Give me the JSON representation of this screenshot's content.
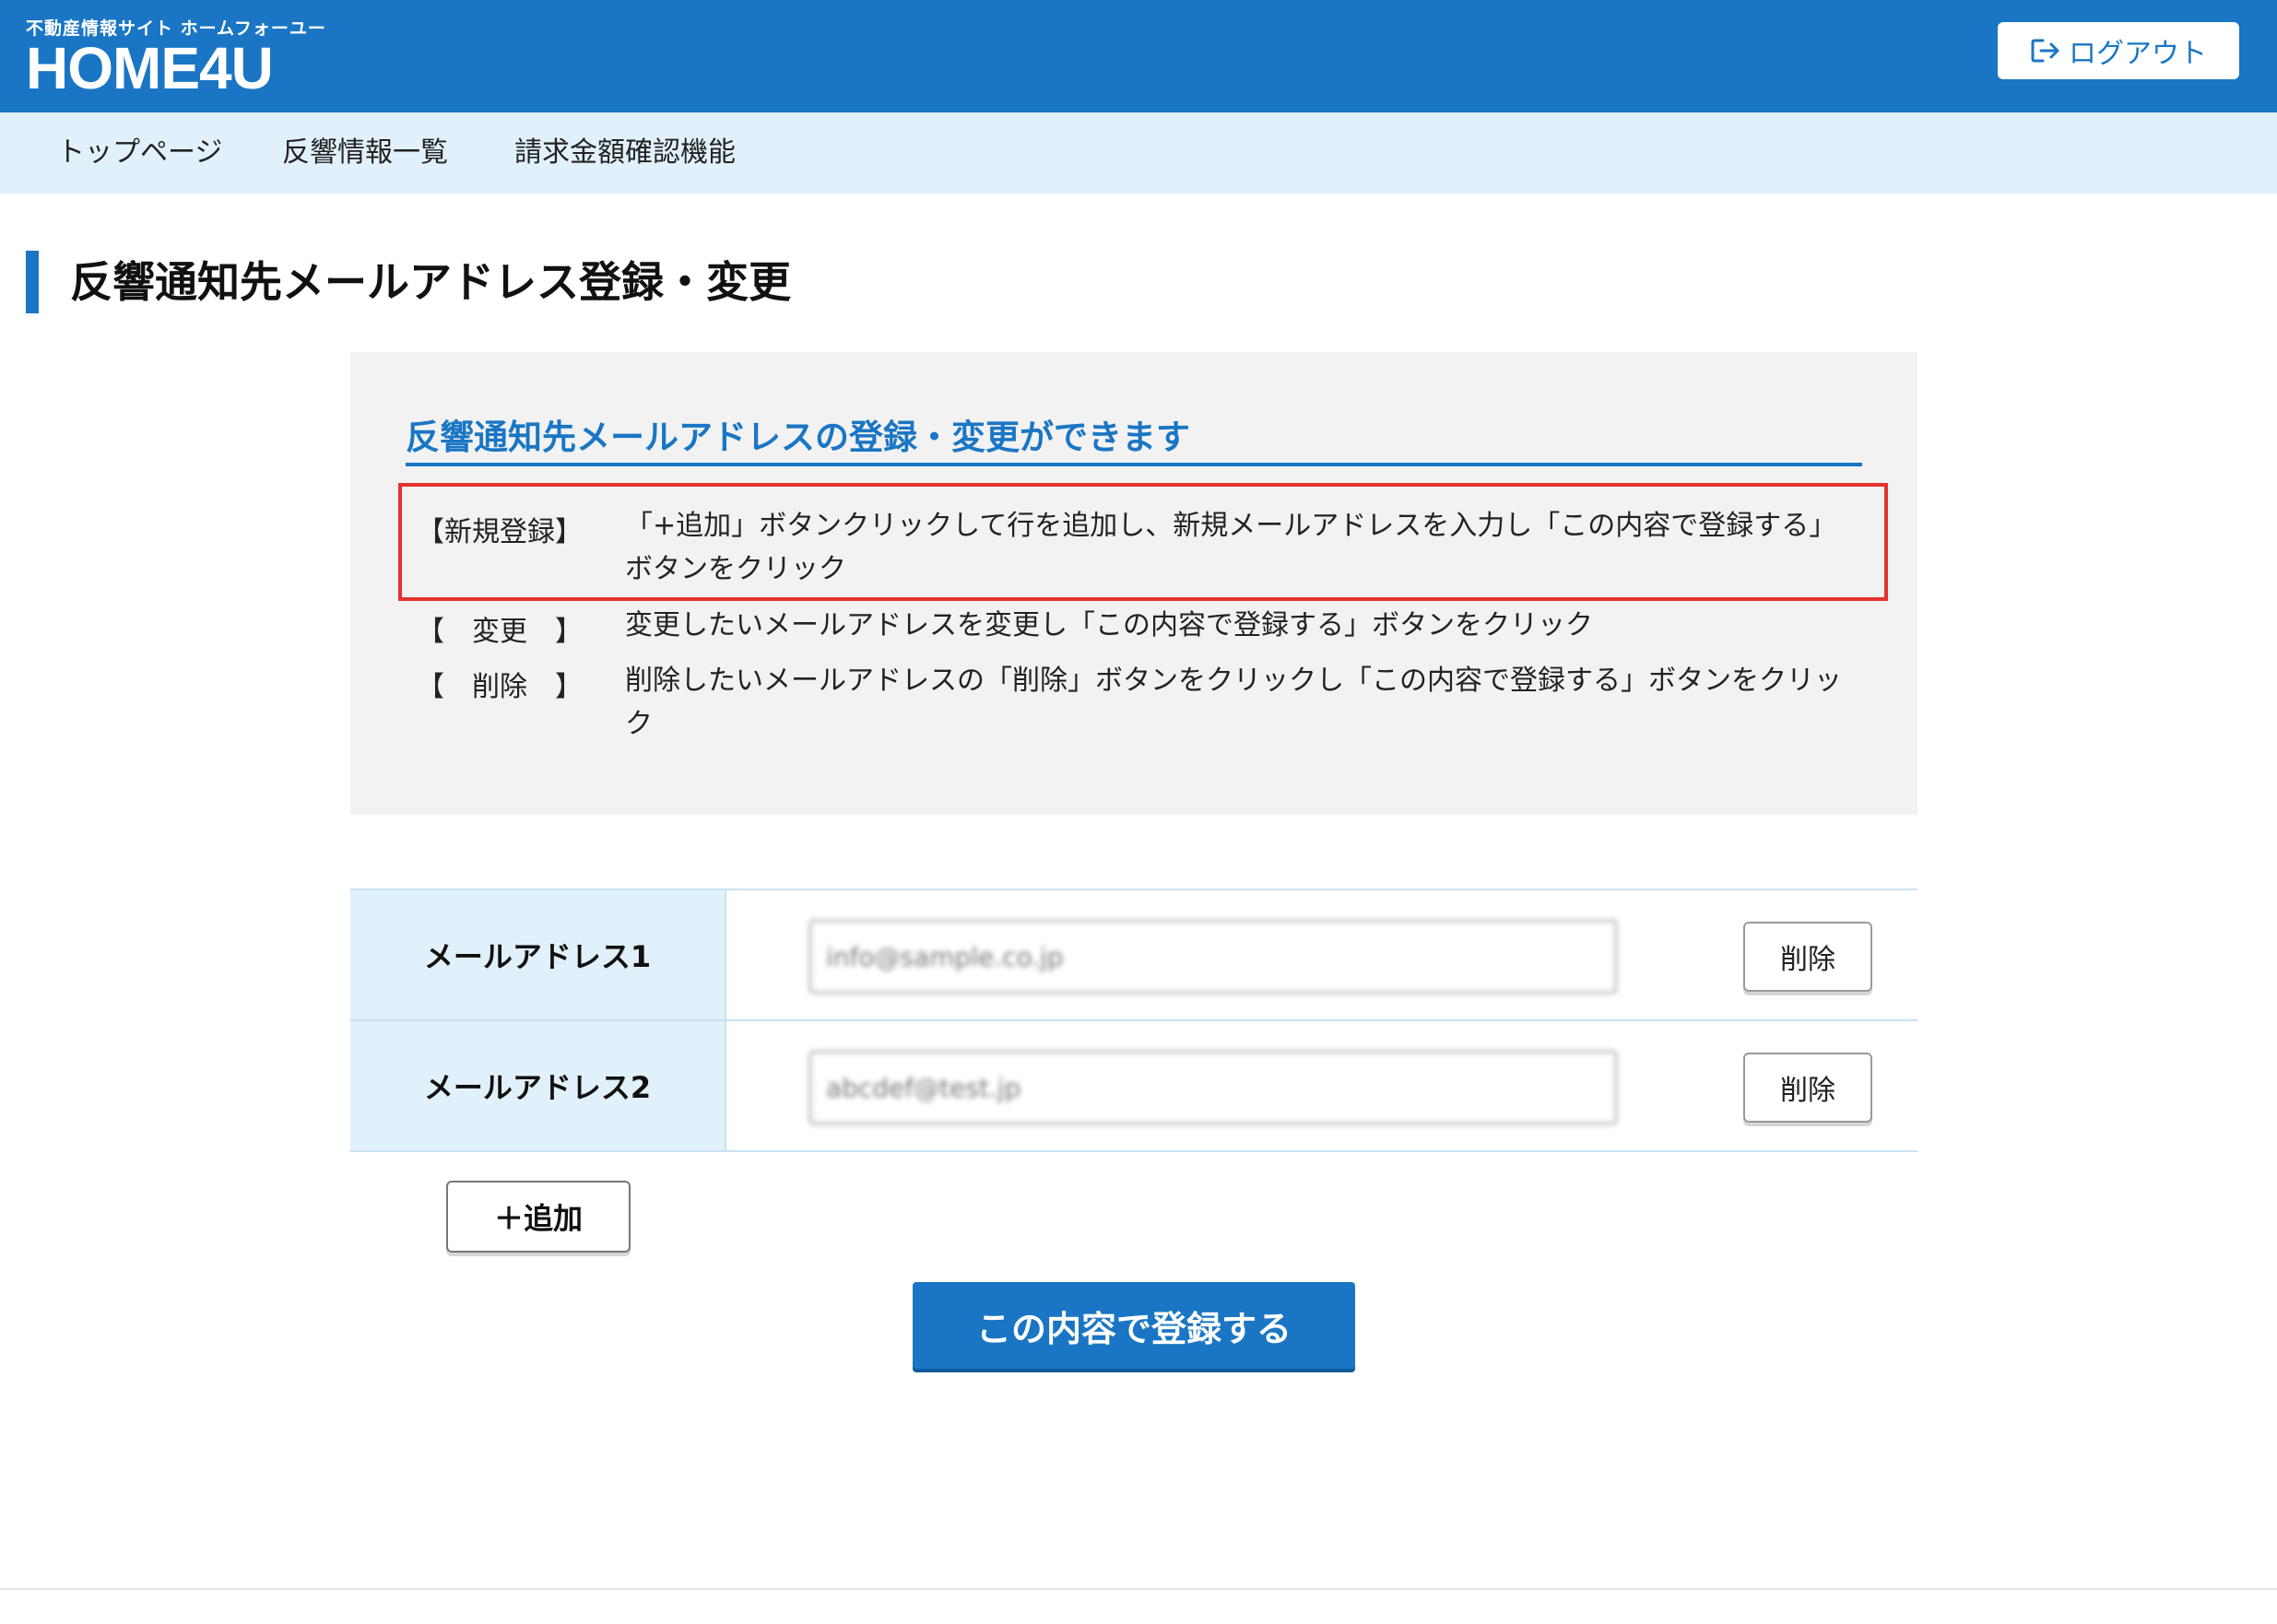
{
  "header": {
    "logo_subtitle": "不動産情報サイト ホームフォーユー",
    "logo_title": "HOME4U",
    "logout_label": "ログアウト",
    "logout_icon": "logout-icon"
  },
  "nav": {
    "items": [
      {
        "label": "トップページ"
      },
      {
        "label": "反響情報一覧"
      },
      {
        "label": "請求金額確認機能"
      }
    ]
  },
  "page": {
    "title": "反響通知先メールアドレス登録・変更"
  },
  "info": {
    "heading": "反響通知先メールアドレスの登録・変更ができます",
    "instructions": [
      {
        "label": "【新規登録】",
        "text": "「+追加」ボタンクリックして行を追加し、新規メールアドレスを入力し「この内容で登録する」ボタンをクリック"
      },
      {
        "label": "【　変更　】",
        "text": "変更したいメールアドレスを変更し「この内容で登録する」ボタンをクリック"
      },
      {
        "label": "【　削除　】",
        "text": "削除したいメールアドレスの「削除」ボタンをクリックし「この内容で登録する」ボタンをクリック"
      }
    ]
  },
  "emails": [
    {
      "label": "メールアドレス1",
      "value": "info@sample.co.jp",
      "delete_label": "削除"
    },
    {
      "label": "メールアドレス2",
      "value": "abcdef@test.jp",
      "delete_label": "削除"
    }
  ],
  "actions": {
    "add_label": "＋追加",
    "submit_label": "この内容で登録する"
  },
  "colors": {
    "brand": "#1a76c4",
    "nav_bg": "#e1f1fb",
    "info_bg": "#f2f2f2",
    "highlight": "#e5322d"
  }
}
